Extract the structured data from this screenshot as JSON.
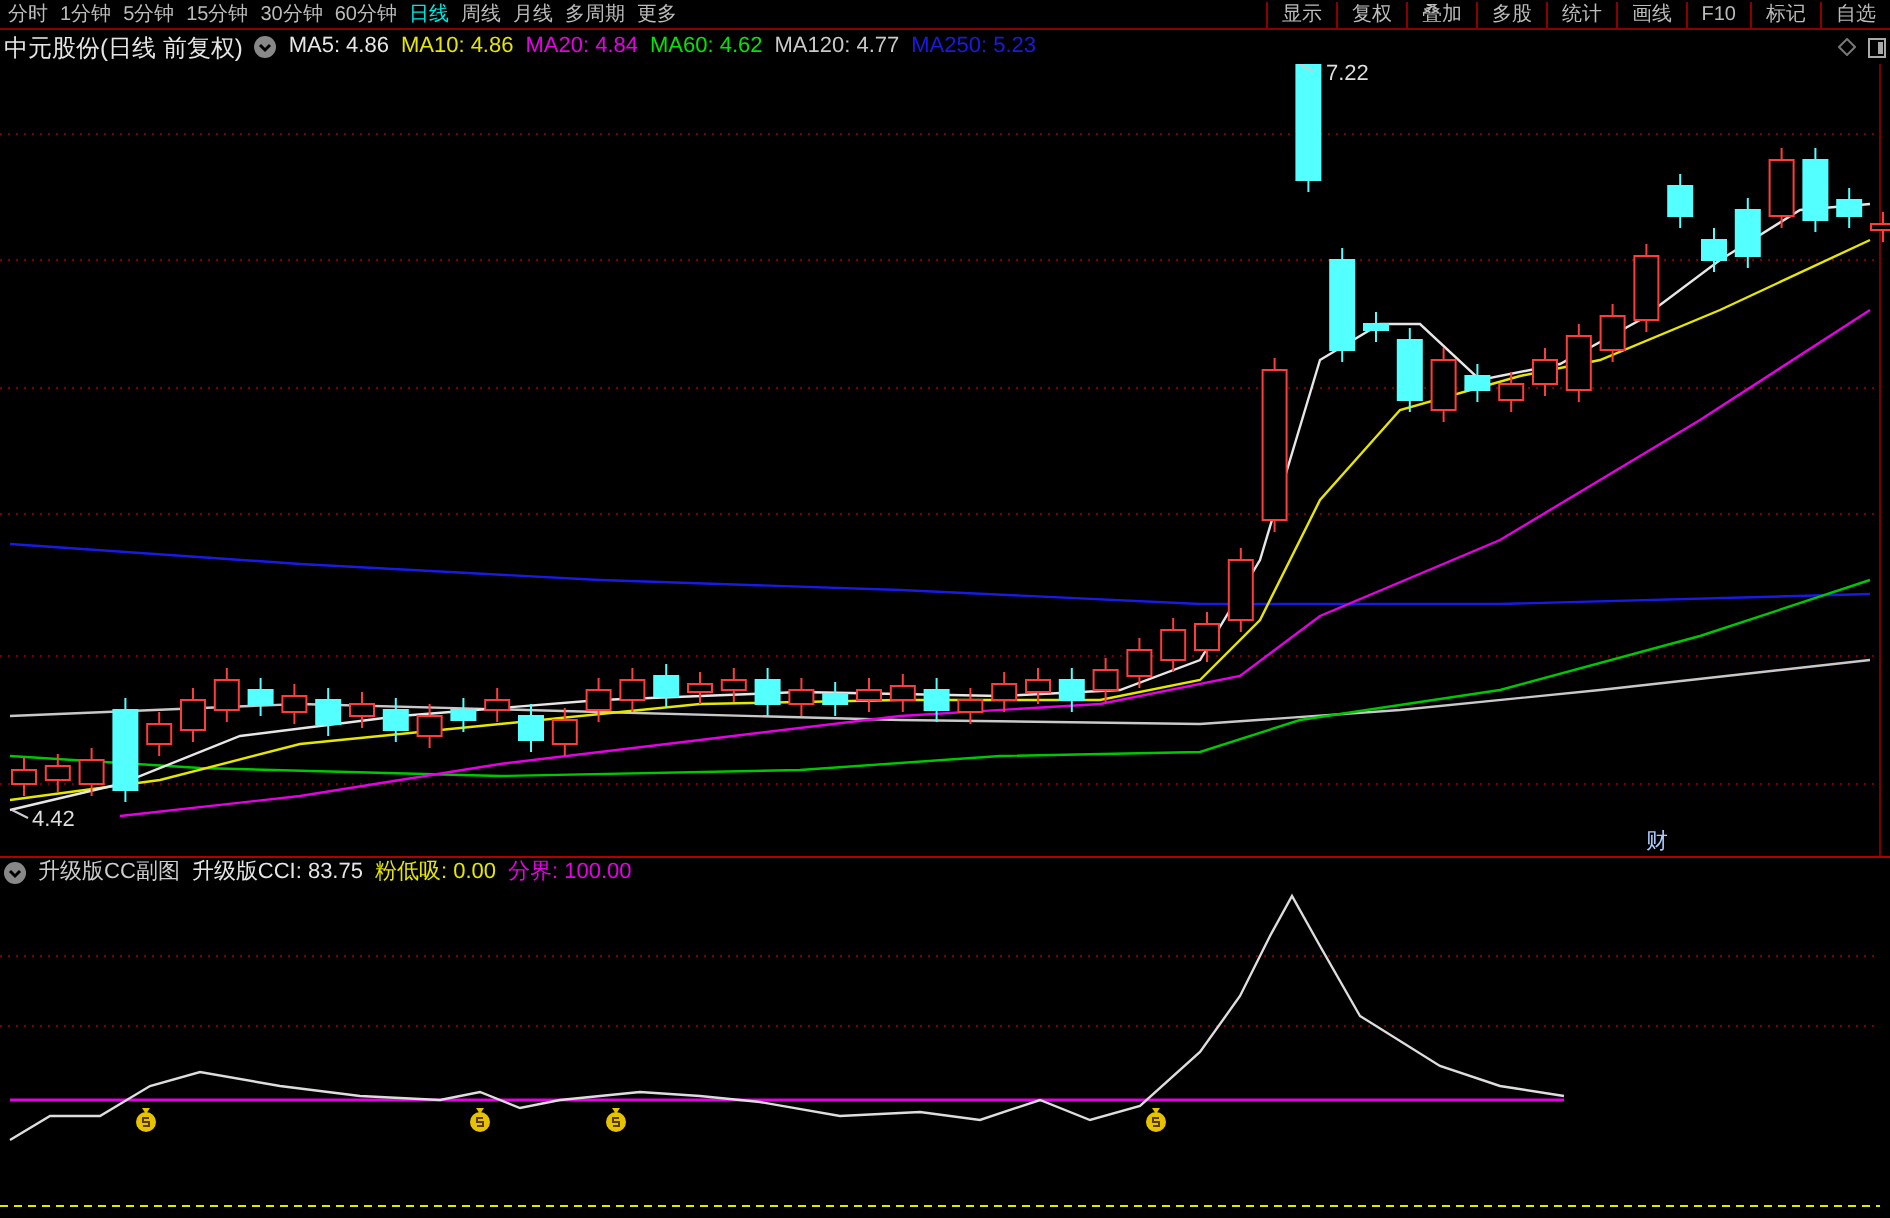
{
  "toolbar": {
    "periods": [
      {
        "label": "分时",
        "selected": false
      },
      {
        "label": "1分钟",
        "selected": false
      },
      {
        "label": "5分钟",
        "selected": false
      },
      {
        "label": "15分钟",
        "selected": false
      },
      {
        "label": "30分钟",
        "selected": false
      },
      {
        "label": "60分钟",
        "selected": false
      },
      {
        "label": "日线",
        "selected": true
      },
      {
        "label": "周线",
        "selected": false
      },
      {
        "label": "月线",
        "selected": false
      },
      {
        "label": "多周期",
        "selected": false
      },
      {
        "label": "更多",
        "selected": false
      }
    ],
    "buttons": [
      "显示",
      "复权",
      "叠加",
      "多股",
      "统计",
      "画线",
      "F10",
      "标记",
      "自选"
    ]
  },
  "main_chart": {
    "title": "中元股份(日线 前复权)",
    "indicators": [
      {
        "label": "MA5: 4.86",
        "color": "#e6e6e6"
      },
      {
        "label": "MA10: 4.86",
        "color": "#e6e600"
      },
      {
        "label": "MA20: 4.84",
        "color": "#e600e6"
      },
      {
        "label": "MA60: 4.62",
        "color": "#00e600"
      },
      {
        "label": "MA120: 4.77",
        "color": "#c8c8c8"
      },
      {
        "label": "MA250: 5.23",
        "color": "#1a1ae6"
      }
    ],
    "high_label": "7.22",
    "low_label": "4.42",
    "event_marker": "财"
  },
  "sub_chart": {
    "title": "升级版CC副图",
    "values": [
      {
        "label": "升级版CCI: 83.75",
        "color": "#e6e6e6"
      },
      {
        "label": "粉低吸: 0.00",
        "color": "#e6e600"
      },
      {
        "label": "分界: 100.00",
        "color": "#e600e6"
      }
    ]
  }
}
